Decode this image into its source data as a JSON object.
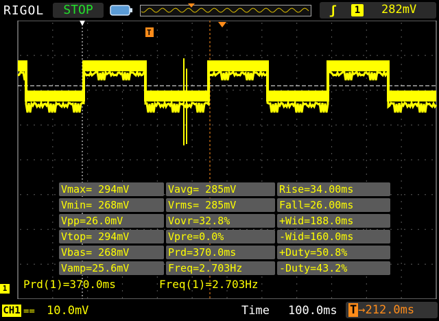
{
  "header": {
    "brand": "RIGOL",
    "run_state": "STOP",
    "trigger_edge_symbol": "ʃ",
    "trigger_source": "1",
    "trigger_level": "282mV"
  },
  "measurements": {
    "rows": [
      [
        "Vmax= 294mV",
        "Vavg= 285mV",
        "Rise=34.00ms"
      ],
      [
        "Vmin= 268mV",
        "Vrms= 285mV",
        "Fall=26.00ms"
      ],
      [
        "Vpp=26.0mV",
        "Vovr=32.8%",
        "+Wid=188.0ms"
      ],
      [
        "Vtop= 294mV",
        "Vpre=0.0%",
        "-Wid=160.0ms"
      ],
      [
        "Vbas= 268mV",
        "Prd=370.0ms",
        "+Duty=50.8%"
      ],
      [
        "Vamp=25.6mV",
        "Freq=2.703Hz",
        "-Duty=43.2%"
      ]
    ],
    "prd_readout": "Prd(1)=370.0ms",
    "freq_readout": "Freq(1)=2.703Hz"
  },
  "footer": {
    "channel_label": "CH1",
    "channel_marker": "1",
    "channel_coupling": "==",
    "channel_scale": "10.0mV",
    "time_label": "Time",
    "time_scale": "100.0ms",
    "trigger_position": "→212.0ms",
    "trigger_position_marker": "T"
  },
  "colors": {
    "trace": "#ffff00",
    "trigger_marker": "#ff8c1a",
    "stop": "#22e02a"
  }
}
